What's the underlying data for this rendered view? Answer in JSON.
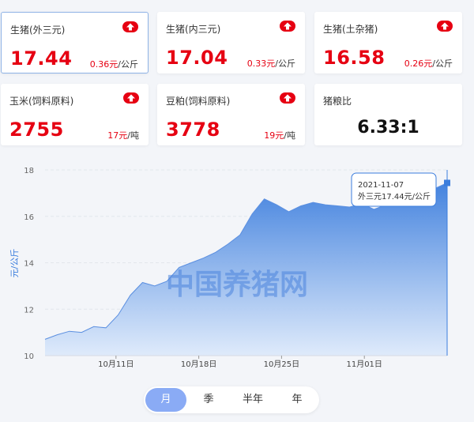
{
  "cards": [
    {
      "title": "生猪(外三元)",
      "price": "17.44",
      "change": "0.36元",
      "unit": "/公斤"
    },
    {
      "title": "生猪(内三元)",
      "price": "17.04",
      "change": "0.33元",
      "unit": "/公斤"
    },
    {
      "title": "生猪(土杂猪)",
      "price": "16.58",
      "change": "0.26元",
      "unit": "/公斤"
    },
    {
      "title": "玉米(饲料原料)",
      "price": "2755",
      "change": "17元",
      "unit": "/吨"
    },
    {
      "title": "豆粕(饲料原料)",
      "price": "3778",
      "change": "19元",
      "unit": "/吨"
    },
    {
      "title": "猪粮比",
      "value": "6.33:1"
    }
  ],
  "icons": {
    "trend": "up-arrow-icon"
  },
  "colors": {
    "up": "#e60012",
    "accent": "#3b7ddd",
    "tab_active": "#8aabf5"
  },
  "watermark": "中国养猪网",
  "tooltip": {
    "date": "2021-11-07",
    "text": "外三元17.44元/公斤"
  },
  "chart_data": {
    "type": "area",
    "ylabel": "元/公斤",
    "ylim": [
      10,
      18
    ],
    "yticks": [
      10,
      12,
      14,
      16,
      18
    ],
    "xlim": [
      0,
      34
    ],
    "xticks": [
      {
        "x": 6,
        "label": "10月11日"
      },
      {
        "x": 13,
        "label": "10月18日"
      },
      {
        "x": 20,
        "label": "10月25日"
      },
      {
        "x": 27,
        "label": "11月01日"
      }
    ],
    "series": [
      {
        "name": "外三元",
        "values": [
          10.7,
          10.9,
          11.05,
          11.0,
          11.25,
          11.2,
          11.75,
          12.6,
          13.15,
          13.0,
          13.2,
          13.8,
          14.0,
          14.2,
          14.45,
          14.8,
          15.2,
          16.1,
          16.75,
          16.5,
          16.2,
          16.45,
          16.6,
          16.5,
          16.45,
          16.4,
          16.55,
          16.3,
          16.5,
          16.7,
          16.85,
          17.05,
          17.2,
          17.44
        ]
      }
    ],
    "highlight_index": 33,
    "grid": true,
    "legend": "none"
  },
  "tabs": [
    "月",
    "季",
    "半年",
    "年"
  ],
  "active_tab": 0
}
